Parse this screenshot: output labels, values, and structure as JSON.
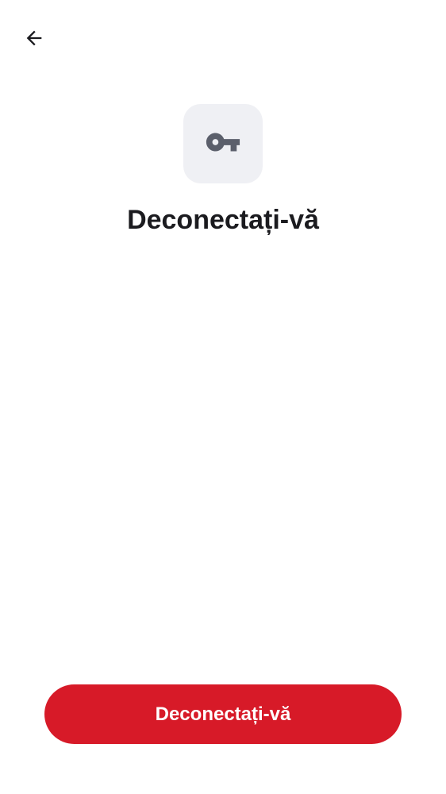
{
  "header": {
    "back_icon": "arrow-left-icon"
  },
  "hero": {
    "icon": "key-icon",
    "title": "Deconectați-vă"
  },
  "footer": {
    "primary_button_label": "Deconectați-vă"
  },
  "colors": {
    "accent": "#d71a28",
    "icon_tile_bg": "#eff0f4",
    "icon_fg": "#5b5f6b",
    "text_primary": "#1b1b1f"
  }
}
